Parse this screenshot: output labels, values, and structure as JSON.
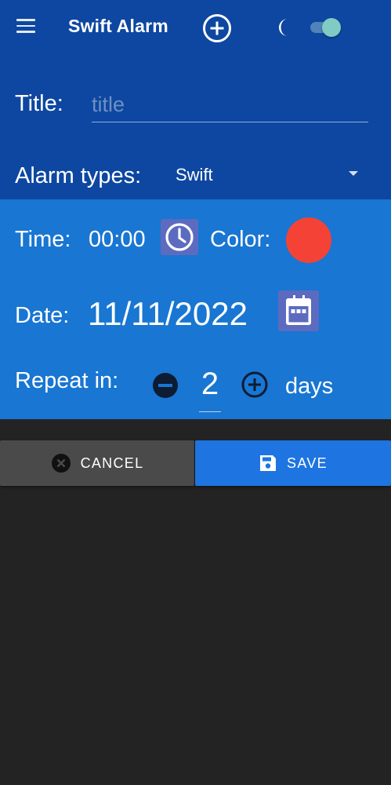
{
  "appbar": {
    "title": "Swift Alarm",
    "icons": {
      "menu": "menu-icon",
      "add": "add-circle-icon",
      "theme": "moon-icon"
    },
    "dark_mode_on": true
  },
  "form": {
    "title_label": "Title:",
    "title_value": "",
    "title_placeholder": "title",
    "alarm_types_label": "Alarm types:",
    "alarm_type_selected": "Swift",
    "time_label": "Time:",
    "time_value": "00:00",
    "color_label": "Color:",
    "color_value": "#f44336",
    "date_label": "Date:",
    "date_value": "11/11/2022",
    "repeat_label": "Repeat in:",
    "repeat_value": "2",
    "repeat_unit": "days"
  },
  "actions": {
    "cancel_label": "CANCEL",
    "save_label": "SAVE"
  },
  "colors": {
    "appbar": "#0d47a1",
    "form_top": "#0d47a1",
    "form_bottom": "#1976d2",
    "background": "#232323",
    "cancel_button": "#4a4a4a",
    "save_button": "#1e74e0",
    "icon_button": "#5c6bc0",
    "toggle_thumb": "#80cbc4"
  }
}
